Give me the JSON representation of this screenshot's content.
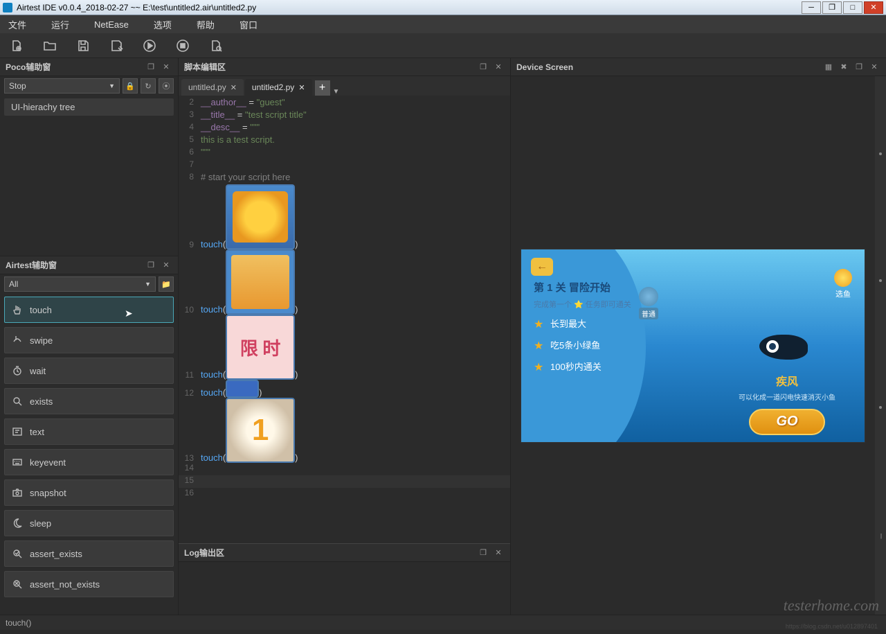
{
  "window": {
    "title": "Airtest IDE v0.0.4_2018-02-27 ~~ E:\\test\\untitled2.air\\untitled2.py"
  },
  "menu": {
    "file": "文件",
    "run": "运行",
    "netease": "NetEase",
    "options": "选项",
    "help": "帮助",
    "window": "窗口"
  },
  "panels": {
    "poco": "Poco辅助窗",
    "airtest": "Airtest辅助窗",
    "script": "脚本编辑区",
    "log": "Log输出区",
    "device": "Device Screen"
  },
  "poco": {
    "selected": "Stop",
    "tree_item": "UI-hierachy tree"
  },
  "airtest": {
    "filter": "All",
    "actions": [
      "touch",
      "swipe",
      "wait",
      "exists",
      "text",
      "keyevent",
      "snapshot",
      "sleep",
      "assert_exists",
      "assert_not_exists"
    ]
  },
  "editor": {
    "tabs": [
      {
        "name": "untitled.py",
        "active": false
      },
      {
        "name": "untitled2.py",
        "active": true
      }
    ],
    "lines": {
      "l2": {
        "num": "2",
        "a": "__author__",
        "b": " = ",
        "c": "\"guest\""
      },
      "l3": {
        "num": "3",
        "a": "__title__",
        "b": " = ",
        "c": "\"test script title\""
      },
      "l4": {
        "num": "4",
        "a": "__desc__",
        "b": " = ",
        "c": "\"\"\""
      },
      "l5": {
        "num": "5",
        "c": "this is a test script."
      },
      "l6": {
        "num": "6",
        "c": "\"\"\""
      },
      "l7": {
        "num": "7"
      },
      "l8": {
        "num": "8",
        "c": "# start your script here"
      },
      "l9": {
        "num": "9",
        "f": "touch",
        "p1": "(",
        "p2": ")"
      },
      "l10": {
        "num": "10",
        "f": "touch",
        "p1": "(",
        "p2": ")"
      },
      "l11": {
        "num": "11",
        "f": "touch",
        "p1": "(",
        "p2": ")"
      },
      "l12": {
        "num": "12",
        "f": "touch",
        "p1": "(",
        "p2": ")"
      },
      "l13": {
        "num": "13",
        "f": "touch",
        "p1": "(",
        "p2": ")"
      },
      "l14": {
        "num": "14"
      },
      "l15": {
        "num": "15"
      },
      "l16": {
        "num": "16"
      }
    }
  },
  "device": {
    "level_title": "第 1 关 冒险开始",
    "level_sub": "完成第一个 ⭐ 任务即可通关",
    "task1": "长到最大",
    "task2": "吃5条小绿鱼",
    "task3": "100秒内通关",
    "difficulty": "普通",
    "fish_name": "疾风",
    "fish_desc": "可以化成一道闪电快速消灭小鱼",
    "select_fish": "选鱼",
    "go": "GO"
  },
  "status": {
    "text": "touch()"
  },
  "watermark": "testerhome.com",
  "watermark2": "https://blog.csdn.net/u012897401"
}
